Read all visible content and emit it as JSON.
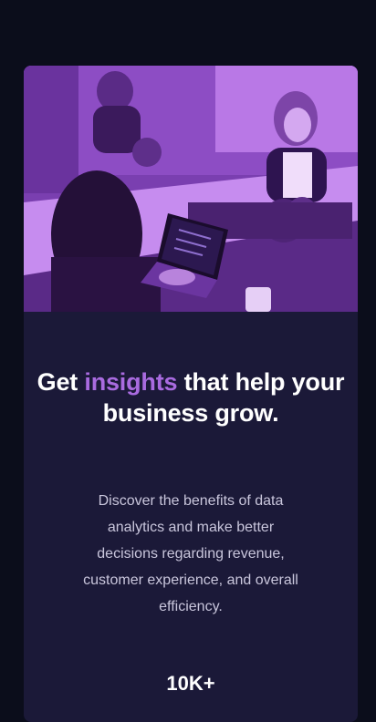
{
  "hero": {
    "image_alt": "Women working with laptops around a table",
    "tint_color": "#a45de0"
  },
  "headline": {
    "part1": "Get ",
    "accent": "insights",
    "part2": " that help your business grow."
  },
  "description": "Discover the benefits of data analytics and make better decisions regarding revenue, customer experience, and overall efficiency.",
  "stats": [
    {
      "value": "10K+"
    }
  ],
  "colors": {
    "page_bg": "#0b0d1b",
    "card_bg": "#1b1938",
    "accent": "#a96be0",
    "text": "#ffffff",
    "muted_text": "#c9c6dc"
  }
}
